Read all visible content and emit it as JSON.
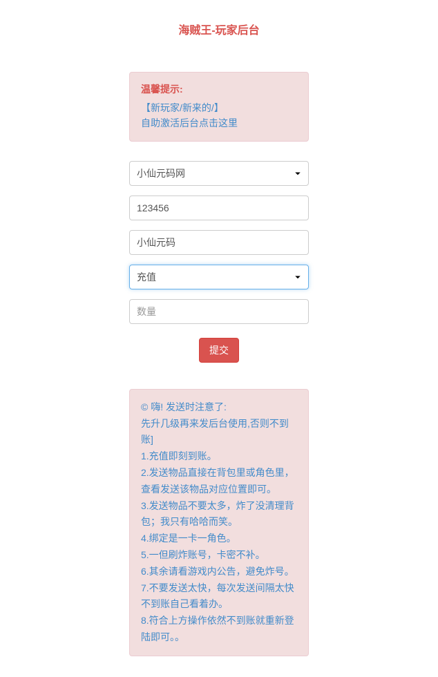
{
  "title": "海贼王-玩家后台",
  "alert": {
    "heading": "温馨提示:",
    "line1": "【新玩家/新来的/】",
    "line2": "自助激活后台点击这里"
  },
  "form": {
    "select1_value": "小仙元码网",
    "input1_value": "123456",
    "input2_value": "小仙元码",
    "select2_value": "充值",
    "input3_placeholder": "数量",
    "submit_label": "提交"
  },
  "info": {
    "line0": "© 嗨! 发送时注意了:",
    "line1": "先升几级再来发后台使用,否则不到账]",
    "line2": "1.充值即刻到账。",
    "line3": "2.发送物品直接在背包里或角色里，查看发送该物品对应位置即可。",
    "line4": "3.发送物品不要太多，炸了没清理背包；我只有哈哈而笑。",
    "line5": "4.绑定是一卡一角色。",
    "line6": "5.一但刷炸账号，卡密不补。",
    "line7": "6.其余请看游戏内公告，避免炸号。",
    "line8": "7.不要发送太快，每次发送间隔太快不到账自己看着办。",
    "line9": "8.符合上方操作依然不到账就重新登陆即可。。"
  }
}
